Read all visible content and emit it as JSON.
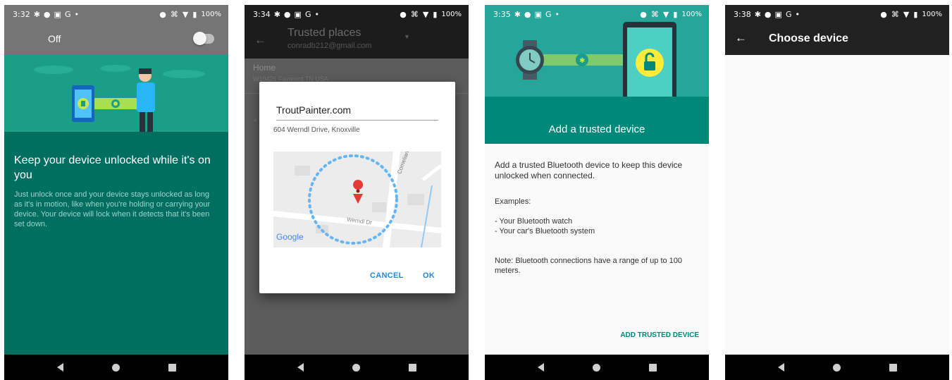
{
  "screens": [
    {
      "status": {
        "time": "3:32",
        "battery": "100%"
      },
      "toggle": {
        "label": "Off",
        "state": "off"
      },
      "title": "Keep your device unlocked while it's on you",
      "description": "Just unlock once and your device stays unlocked as long as it's in motion, like when you're holding or carrying your device. Your device will lock when it detects that it's been set down."
    },
    {
      "status": {
        "time": "3:34",
        "battery": "100%"
      },
      "appbar": {
        "title": "Trusted places",
        "account": "conradb212@gmail.com"
      },
      "list": {
        "home_label": "Home",
        "home_address": "W10426 Fairmont TN USA"
      },
      "dialog": {
        "place_name": "TroutPainter.com",
        "address": "604 Werndl Drive, Knoxville",
        "map": {
          "road_1": "Cornelian Rd",
          "road_2": "Werndl Dr",
          "attribution": "Google"
        },
        "cancel_label": "CANCEL",
        "ok_label": "OK"
      }
    },
    {
      "status": {
        "time": "3:35",
        "battery": "100%"
      },
      "hero_title": "Add a trusted device",
      "intro": "Add a trusted Bluetooth device to keep this device unlocked when connected.",
      "examples_heading": "Examples:",
      "examples": [
        "- Your Bluetooth watch",
        "- Your car's Bluetooth system"
      ],
      "note": "Note: Bluetooth connections have a range of up to 100 meters.",
      "action_label": "ADD TRUSTED DEVICE"
    },
    {
      "status": {
        "time": "3:38",
        "battery": "100%"
      },
      "appbar": {
        "title": "Choose device"
      }
    }
  ],
  "colors": {
    "teal_light": "#26a69a",
    "teal_dark": "#00897b",
    "dialog_blue": "#1e88e5",
    "status_bar_gray": "#757575"
  },
  "icons": {
    "status_left": [
      "gear-icon",
      "location-icon",
      "image-icon",
      "google-icon",
      "dot-icon"
    ],
    "status_right": [
      "circle-icon",
      "no-sim-icon",
      "wifi-icon",
      "battery-icon"
    ],
    "nav": [
      "back-icon",
      "home-icon",
      "recents-icon"
    ]
  }
}
